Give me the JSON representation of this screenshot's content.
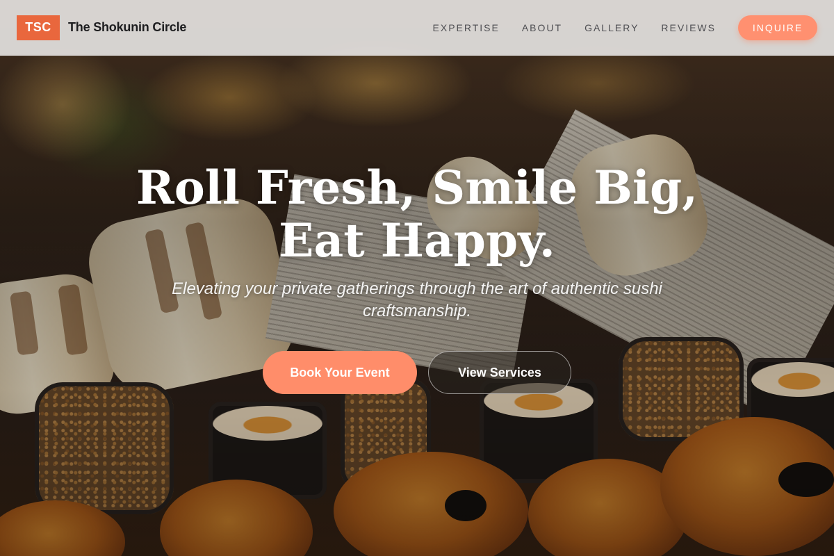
{
  "brand": {
    "logo_mark": "TSC",
    "name": "The Shokunin Circle"
  },
  "nav": {
    "items": [
      {
        "label": "EXPERTISE"
      },
      {
        "label": "ABOUT"
      },
      {
        "label": "GALLERY"
      },
      {
        "label": "REVIEWS"
      }
    ],
    "cta_label": "INQUIRE"
  },
  "hero": {
    "title": "Roll Fresh, Smile Big, Eat Happy.",
    "subtitle": "Elevating your private gatherings through the art of authentic sushi craftsmanship.",
    "primary_button": "Book Your Event",
    "secondary_button": "View Services"
  },
  "colors": {
    "accent": "#e9673d",
    "button_coral": "#ff8d6a",
    "header_bg": "#e8e6e4",
    "nav_text": "#4e4e52"
  }
}
